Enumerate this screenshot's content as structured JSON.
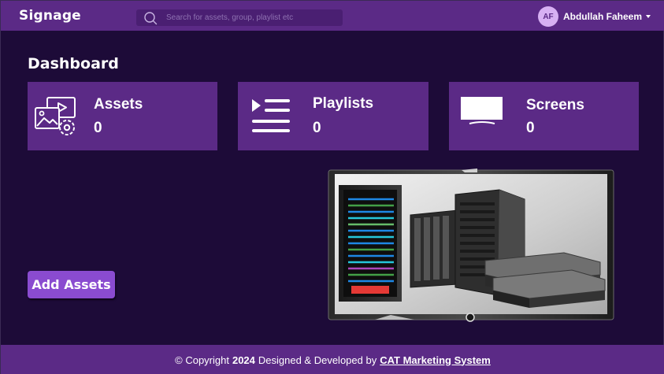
{
  "header": {
    "brand": "Signage",
    "search": {
      "placeholder": "Search for assets, group, playlist etc",
      "value": ""
    },
    "user": {
      "initials": "AF",
      "name": "Abdullah Faheem"
    }
  },
  "page": {
    "title": "Dashboard"
  },
  "cards": {
    "assets": {
      "label": "Assets",
      "count": "0",
      "icon": "media-gear-icon"
    },
    "playlists": {
      "label": "Playlists",
      "count": "0",
      "icon": "playlist-icon"
    },
    "screens": {
      "label": "Screens",
      "count": "0",
      "icon": "screen-icon"
    }
  },
  "actions": {
    "add_assets_label": "Add Assets"
  },
  "footer": {
    "prefix": "© Copyright",
    "year": "2024",
    "middle": "Designed & Developed by",
    "company": "CAT Marketing System"
  },
  "colors": {
    "background": "#1d0b38",
    "header": "#5b2a86",
    "card": "#5b2a86",
    "button": "#8a4bd0",
    "avatar": "#d7b0f3"
  }
}
